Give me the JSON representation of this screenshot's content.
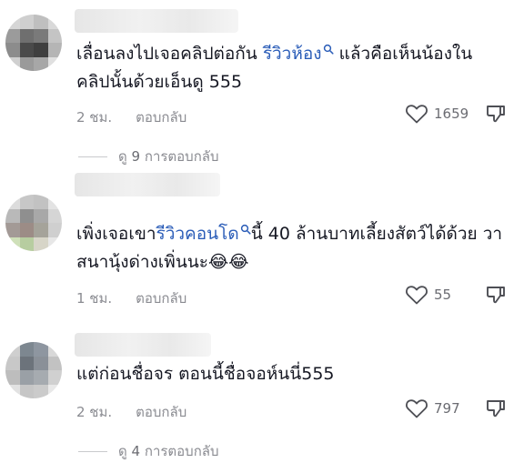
{
  "comments": [
    {
      "text_before": "เลื่อนลงไปเจอคลิปต่อกัน ",
      "link": "รีวิวห้อง",
      "text_after": " แล้วคือเห็นน้องในคลิปนั้นด้วยเอ็นดู 555",
      "time": "2 ชม.",
      "reply_label": "ตอบกลับ",
      "likes": "1659",
      "view_prefix": "ดู",
      "view_count": "9",
      "view_suffix": "การตอบกลับ",
      "avatar_colors": [
        "#d6d6d6",
        "#cfcfcf",
        "#bfbfbf",
        "#d9d9d9",
        "#9b9b9b",
        "#6f6f6f",
        "#7a7a7a",
        "#c4c4c4",
        "#8c8c8c",
        "#4a4a4a",
        "#3f3f3f",
        "#b5b5b5",
        "#d0d0d0",
        "#9a9a9a",
        "#a7a7a7",
        "#e0e0e0"
      ]
    },
    {
      "text_before": "เพิ่งเจอเขา",
      "link": "รีวิวคอนโด",
      "text_after": "นี้ 40 ล้านบาทเลี้ยงสัตว์ได้ด้วย วาสนานุ้งด่างเพิ่นนะ😂😂",
      "time": "1 ชม.",
      "reply_label": "ตอบกลับ",
      "likes": "55",
      "avatar_colors": [
        "#dcdcdc",
        "#c7c7c7",
        "#c2c2c2",
        "#e3e3e3",
        "#b9b9b9",
        "#8f8f8f",
        "#a8a8a8",
        "#d5d5d5",
        "#a39a96",
        "#9c8c86",
        "#a5a39a",
        "#cfcfcf",
        "#cfe0b9",
        "#b7cda0",
        "#d7d5c8",
        "#e7e7e7"
      ]
    },
    {
      "text_before": "แต่ก่อนชื่อจร ตอนนี้ชื่อจอห์นนี่555",
      "link": "",
      "text_after": "",
      "time": "2 ชม.",
      "reply_label": "ตอบกลับ",
      "likes": "797",
      "view_prefix": "ดู",
      "view_count": "4",
      "view_suffix": "การตอบกลับ",
      "avatar_colors": [
        "#cfcfcf",
        "#7d8790",
        "#8e96a0",
        "#d8d8d8",
        "#c8c8c8",
        "#6c737b",
        "#8a9098",
        "#c2c2c2",
        "#bdbdbd",
        "#9aa0a6",
        "#a6abb0",
        "#d0d0d0",
        "#e2e2e2",
        "#c6c6c6",
        "#cbcbcb",
        "#e8e8e8"
      ]
    }
  ]
}
